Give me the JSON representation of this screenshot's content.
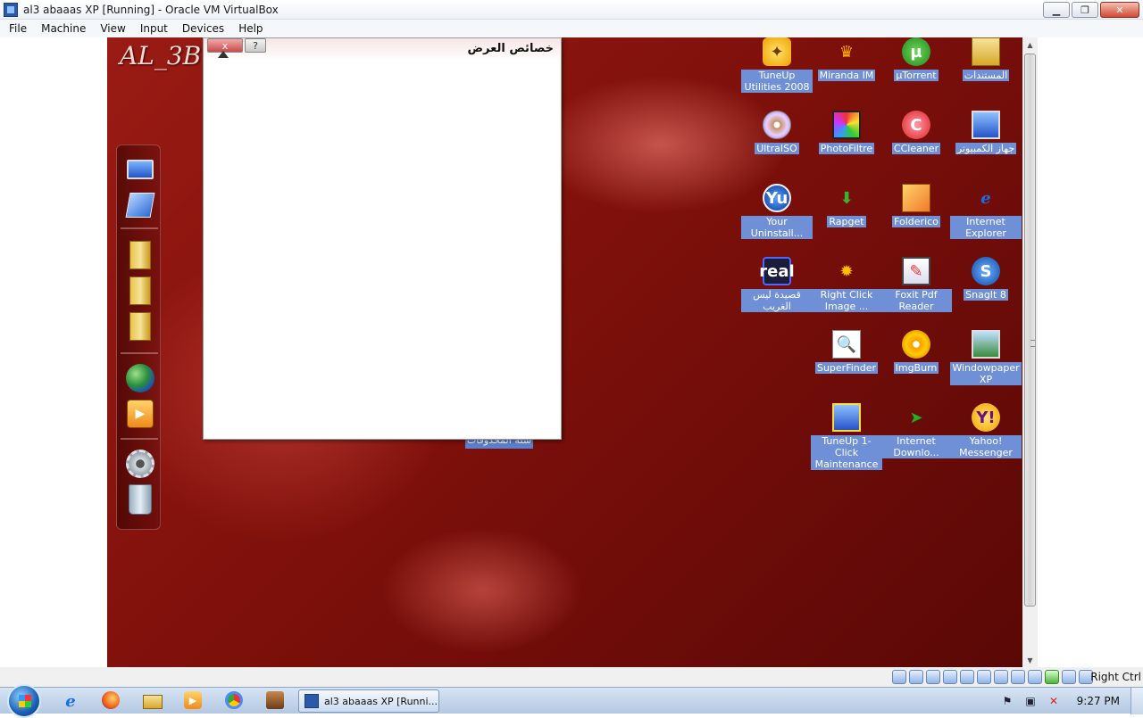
{
  "window": {
    "title": "al3 abaaas XP [Running] - Oracle VM VirtualBox",
    "minimize_glyph": "▁",
    "restore_glyph": "❐",
    "close_glyph": "✕"
  },
  "menubar": {
    "items": [
      "File",
      "Machine",
      "View",
      "Input",
      "Devices",
      "Help"
    ]
  },
  "guest": {
    "logo_text": "AL_3B",
    "dialog": {
      "title": "خصائص العرض",
      "close_glyph": "x",
      "help_glyph": "?"
    },
    "partial_icon_label": "سلة المحذوفات",
    "dock": {
      "items": [
        "my-computer-icon",
        "network-icon",
        "folder-icon",
        "documents-folder-icon",
        "pictures-folder-icon",
        "globe-icon",
        "media-player-icon",
        "settings-gear-icon",
        "recycle-bin-icon"
      ]
    },
    "desktop_icons": [
      {
        "label": "TuneUp Utilities 2008",
        "icon": "tuneup-icon",
        "glyph": "✦"
      },
      {
        "label": "Miranda IM",
        "icon": "miranda-icon",
        "glyph": "♛"
      },
      {
        "label": "µTorrent",
        "icon": "utorrent-icon",
        "glyph": "µ"
      },
      {
        "label": "المستندات",
        "icon": "documents-folder-icon",
        "glyph": ""
      },
      {
        "label": "UltraISO",
        "icon": "ultraiso-icon",
        "glyph": ""
      },
      {
        "label": "PhotoFiltre",
        "icon": "photofiltre-icon",
        "glyph": ""
      },
      {
        "label": "CCleaner",
        "icon": "ccleaner-icon",
        "glyph": "C"
      },
      {
        "label": "جهاز الكمبيوتر",
        "icon": "my-computer-icon",
        "glyph": ""
      },
      {
        "label": "Your Uninstall...",
        "icon": "your-uninstaller-icon",
        "glyph": "Yu"
      },
      {
        "label": "Rapget",
        "icon": "rapget-icon",
        "glyph": "⬇"
      },
      {
        "label": "Folderico",
        "icon": "folderico-icon",
        "glyph": ""
      },
      {
        "label": "Internet Explorer",
        "icon": "internet-explorer-icon",
        "glyph": "e"
      },
      {
        "label": "قصيدة ليس الغريب",
        "icon": "realplayer-icon",
        "glyph": "real"
      },
      {
        "label": "Right Click Image ...",
        "icon": "right-click-image-icon",
        "glyph": "✹"
      },
      {
        "label": "Foxit Pdf Reader",
        "icon": "foxit-reader-icon",
        "glyph": "✎"
      },
      {
        "label": "SnagIt 8",
        "icon": "snagit-icon",
        "glyph": "S"
      },
      {
        "label": "SuperFinder",
        "icon": "superfinder-icon",
        "glyph": "🔍"
      },
      {
        "label": "ImgBurn",
        "icon": "imgburn-icon",
        "glyph": ""
      },
      {
        "label": "Windowpaper XP",
        "icon": "windowpaper-icon",
        "glyph": ""
      },
      {
        "label": "TuneUp 1-Click Maintenance",
        "icon": "tuneup-maintenance-icon",
        "glyph": ""
      },
      {
        "label": "Internet Downlo...",
        "icon": "internet-download-manager-icon",
        "glyph": "➤"
      },
      {
        "label": "Yahoo! Messenger",
        "icon": "yahoo-messenger-icon",
        "glyph": "Y!"
      }
    ]
  },
  "vbox_status": {
    "host_key": "Right Ctrl"
  },
  "taskbar": {
    "task_label": "al3 abaaas XP [Runni...",
    "clock": "9:27 PM",
    "media_glyph": "▶",
    "misc_glyph": ""
  },
  "colors": {
    "desktop_red": "#8b140e",
    "icon_label_bg": "#6f8fd6",
    "taskbar": "#c6d6ea"
  }
}
